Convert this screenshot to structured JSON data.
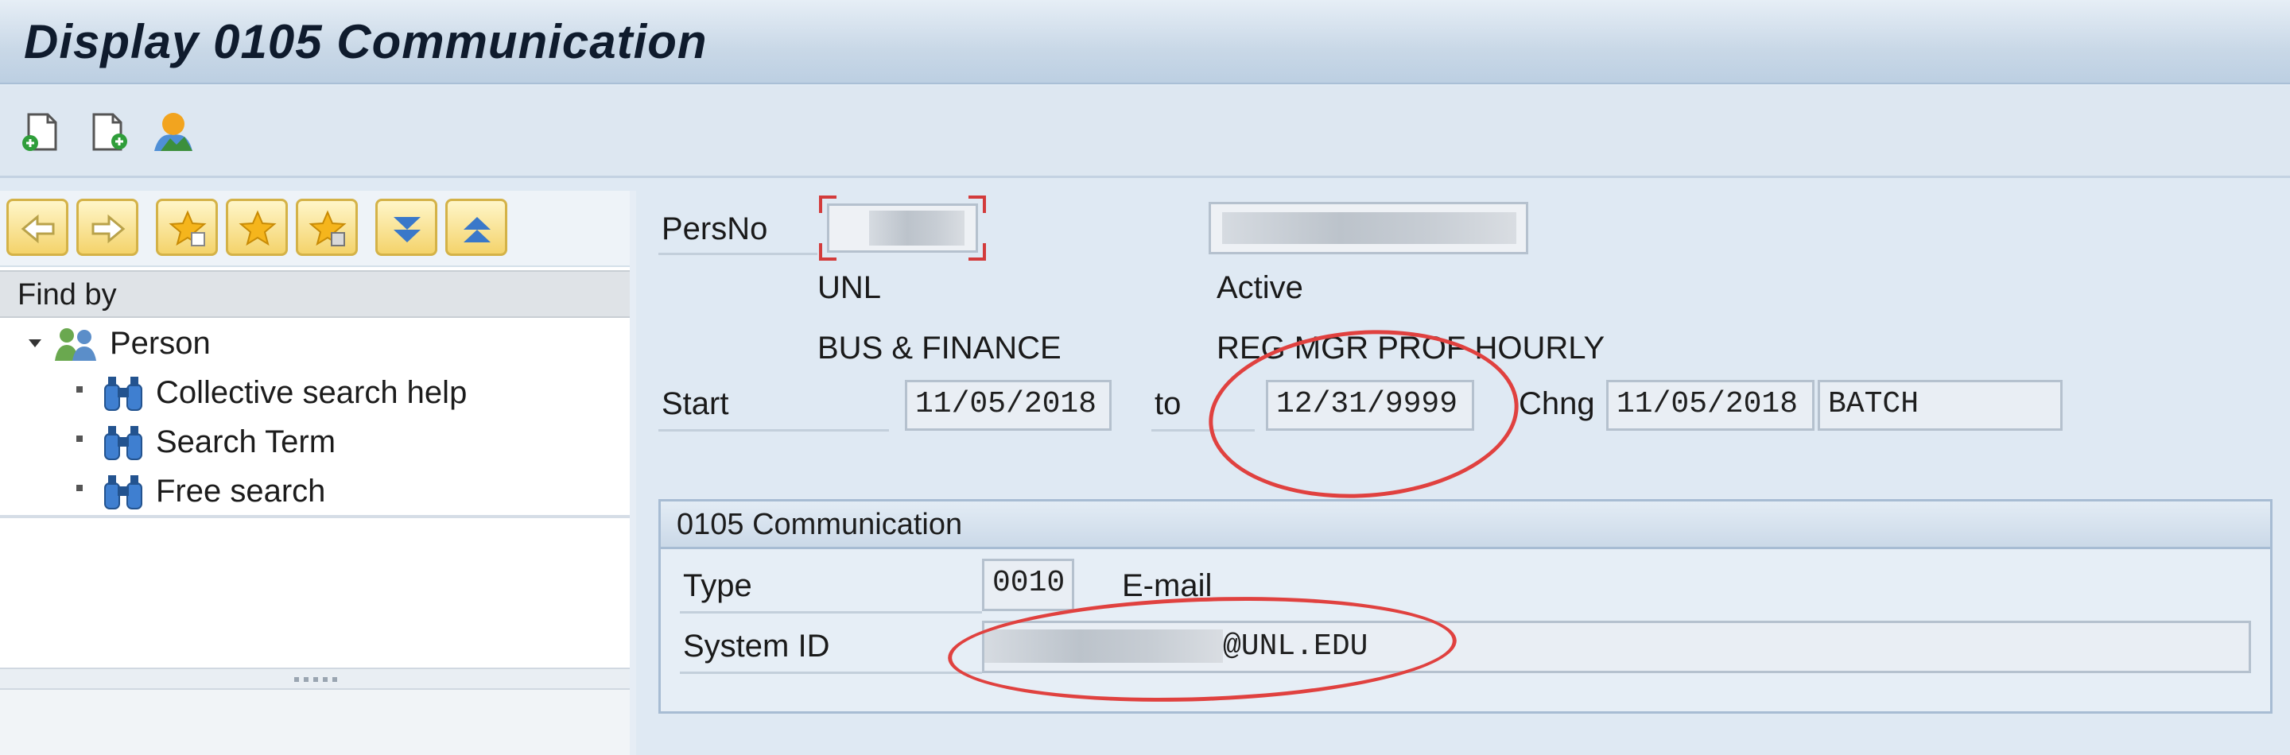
{
  "window": {
    "title": "Display 0105 Communication"
  },
  "toolbar": {
    "icons": [
      "new-document-icon",
      "copy-document-icon",
      "person-overview-icon"
    ]
  },
  "nav": {
    "buttons": [
      "arrow-left-icon",
      "arrow-right-icon",
      "favorite-add-icon",
      "favorite-icon",
      "favorite-delete-icon",
      "expand-all-icon",
      "collapse-all-icon"
    ],
    "find_by": "Find by",
    "tree": {
      "root": "Person",
      "items": [
        "Collective search help",
        "Search Term",
        "Free search"
      ]
    }
  },
  "header": {
    "persno_label": "PersNo",
    "org_unit": "UNL",
    "status": "Active",
    "department": "BUS & FINANCE",
    "employee_group": "REG MGR PROF HOURLY",
    "start_label": "Start",
    "start_date": "11/05/2018",
    "to_label": "to",
    "end_date": "12/31/9999",
    "chng_label": "Chng",
    "chng_date": "11/05/2018",
    "chng_by": "BATCH"
  },
  "group": {
    "title": "0105 Communication",
    "type_label": "Type",
    "type_code": "0010",
    "type_text": "E-mail",
    "sysid_label": "System ID",
    "sysid_suffix": "@UNL.EDU"
  },
  "colors": {
    "highlight_ellipse": "#e0413f",
    "title_bar": "#c9d8e7"
  }
}
